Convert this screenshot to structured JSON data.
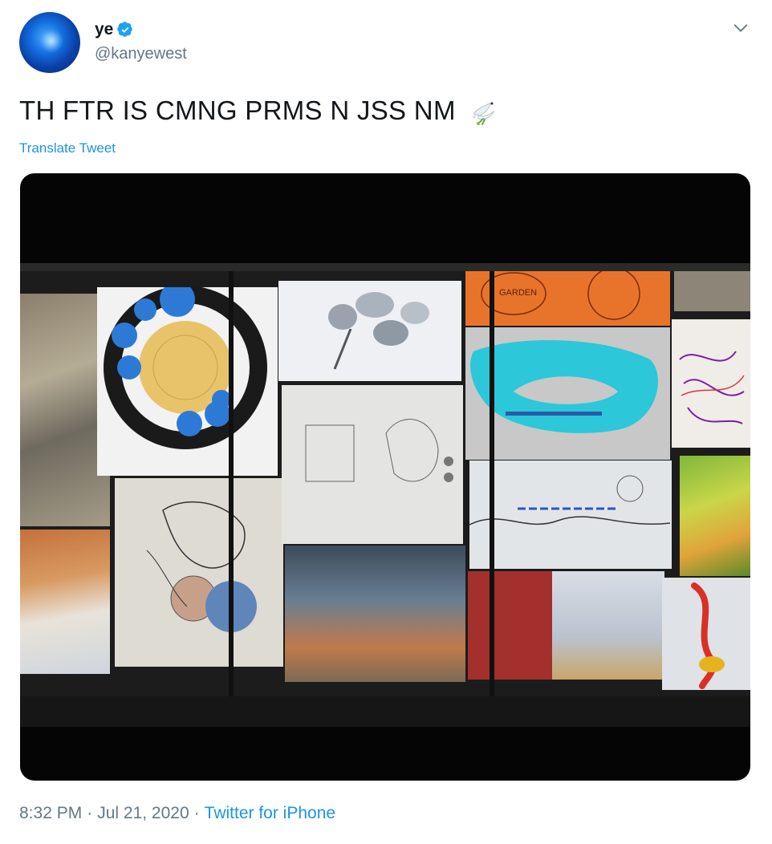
{
  "tweet": {
    "display_name": "ye",
    "handle": "@kanyewest",
    "text": "TH FTR IS CMNG PRMS N JSS NM",
    "emoji_icon": "dove-icon",
    "translate_label": "Translate Tweet",
    "time": "8:32 PM",
    "separator_1": "·",
    "date": "Jul 21, 2020",
    "separator_2": "·",
    "source": "Twitter for iPhone",
    "verified_icon": "verified-badge-icon",
    "menu_icon": "chevron-down-icon"
  },
  "photo": {
    "written_notes": [
      "GARDEN"
    ]
  },
  "colors": {
    "link": "#1b95e0",
    "secondary_text": "#657786",
    "primary_text": "#14171a",
    "verified": "#1da1f2"
  }
}
